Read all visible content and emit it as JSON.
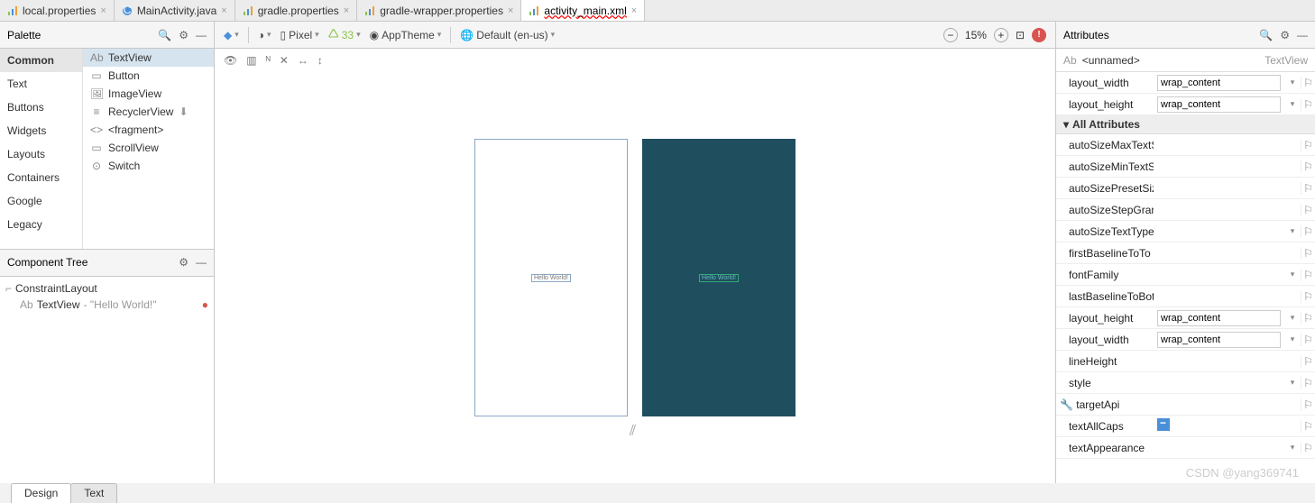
{
  "tabs": [
    {
      "label": "local.properties",
      "icon": "gradle"
    },
    {
      "label": "MainActivity.java",
      "icon": "java"
    },
    {
      "label": "gradle.properties",
      "icon": "gradle"
    },
    {
      "label": "gradle-wrapper.properties",
      "icon": "gradle"
    },
    {
      "label": "activity_main.xml",
      "icon": "xml",
      "active": true,
      "wavy": true
    }
  ],
  "palette": {
    "title": "Palette",
    "categories": [
      "Common",
      "Text",
      "Buttons",
      "Widgets",
      "Layouts",
      "Containers",
      "Google",
      "Legacy"
    ],
    "selected_cat": "Common",
    "items": [
      {
        "label": "TextView",
        "icon": "Ab",
        "selected": true
      },
      {
        "label": "Button",
        "icon": "▭"
      },
      {
        "label": "ImageView",
        "icon": "🖼"
      },
      {
        "label": "RecyclerView",
        "icon": "≡",
        "download": true
      },
      {
        "label": "<fragment>",
        "icon": "<>"
      },
      {
        "label": "ScrollView",
        "icon": "▭"
      },
      {
        "label": "Switch",
        "icon": "⊙"
      }
    ]
  },
  "tree": {
    "title": "Component Tree",
    "root": "ConstraintLayout",
    "child_label": "TextView",
    "child_text": "- \"Hello World!\""
  },
  "design_toolbar": {
    "device": "Pixel",
    "api": "33",
    "theme": "AppTheme",
    "locale": "Default (en-us)",
    "zoom": "15%"
  },
  "canvas": {
    "text": "Hello World!"
  },
  "attributes": {
    "title": "Attributes",
    "component": "<unnamed>",
    "component_type": "TextView",
    "top": [
      {
        "name": "layout_width",
        "val": "wrap_content",
        "drop": true
      },
      {
        "name": "layout_height",
        "val": "wrap_content",
        "drop": true
      }
    ],
    "section": "All Attributes",
    "all": [
      {
        "name": "autoSizeMaxTextS"
      },
      {
        "name": "autoSizeMinTextS"
      },
      {
        "name": "autoSizePresetSiz"
      },
      {
        "name": "autoSizeStepGran"
      },
      {
        "name": "autoSizeTextType",
        "drop": true
      },
      {
        "name": "firstBaselineToTo"
      },
      {
        "name": "fontFamily",
        "drop": true
      },
      {
        "name": "lastBaselineToBot"
      },
      {
        "name": "layout_height",
        "val": "wrap_content",
        "drop": true
      },
      {
        "name": "layout_width",
        "val": "wrap_content",
        "drop": true
      },
      {
        "name": "lineHeight"
      },
      {
        "name": "style",
        "drop": true
      },
      {
        "name": "targetApi",
        "wrench": true
      },
      {
        "name": "textAllCaps",
        "check": true
      },
      {
        "name": "textAppearance",
        "drop": true
      }
    ]
  },
  "bottom_tabs": [
    "Design",
    "Text"
  ],
  "watermark": "CSDN @yang369741"
}
